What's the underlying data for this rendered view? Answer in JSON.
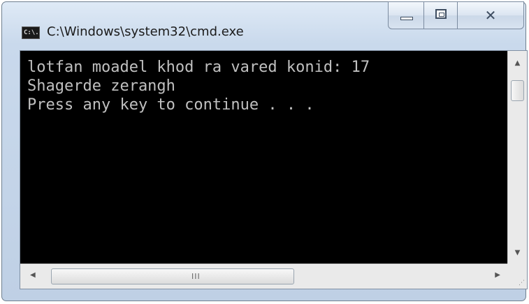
{
  "window": {
    "title": "C:\\Windows\\system32\\cmd.exe",
    "icon_text": "C:\\."
  },
  "caption_buttons": {
    "minimize": "minimize-icon",
    "maximize": "maximize-icon",
    "close": "close-icon",
    "close_glyph": "✕"
  },
  "console": {
    "lines": [
      "lotfan moadel khod ra vared konid: 17",
      "Shagerde zerangh",
      "Press any key to continue . . ."
    ],
    "background": "#000000",
    "foreground": "#c0c0c0"
  },
  "scrollbars": {
    "up_arrow": "▲",
    "down_arrow": "▼",
    "left_arrow": "◀",
    "right_arrow": "▶",
    "grip": "III",
    "sizegrip": "⋰"
  }
}
